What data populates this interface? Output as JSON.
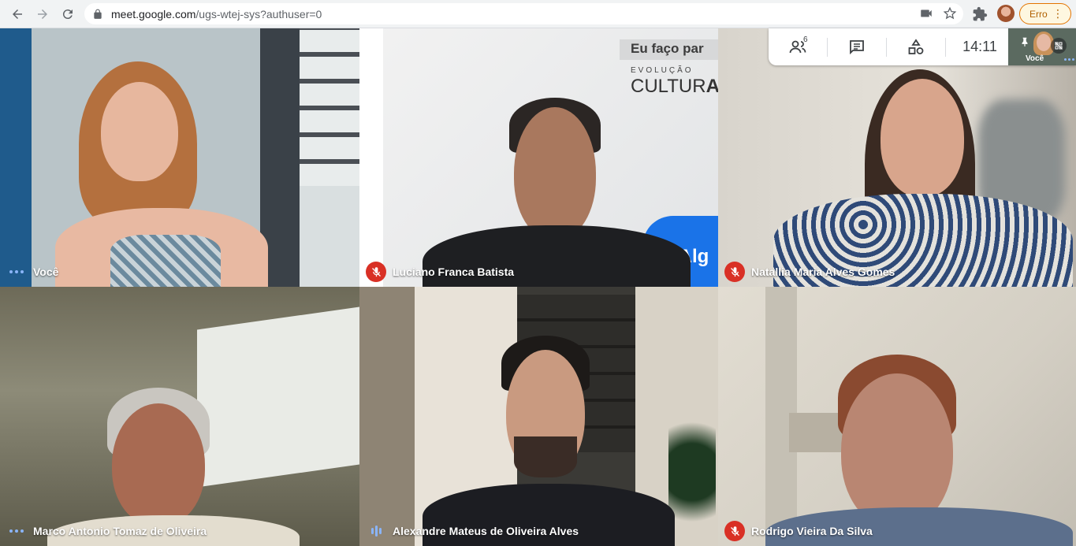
{
  "browser": {
    "url_host": "meet.google.com",
    "url_path": "/ugs-wtej-sys?authuser=0",
    "profile_button_label": "Erro"
  },
  "meeting_bar": {
    "participant_count": "6",
    "clock": "14:11",
    "self_view_label": "Você"
  },
  "participants": [
    {
      "name": "Você",
      "status": "speaking-dots"
    },
    {
      "name": "Luciano Franca Batista",
      "status": "muted"
    },
    {
      "name": "Natallia Maria Alves Gomes",
      "status": "muted"
    },
    {
      "name": "Marco Antonio Tomaz de Oliveira",
      "status": "speaking-dots"
    },
    {
      "name": "Alexandre Mateus de Oliveira Alves",
      "status": "speaking-bars"
    },
    {
      "name": "Rodrigo Vieira Da Silva",
      "status": "muted"
    }
  ],
  "backdrop": {
    "banner_text": "Eu faço par",
    "sub_text": "EVOLUÇÃO",
    "brand_text_a": "CULTUR",
    "brand_text_b": "AL",
    "logo_fragment": "iAlg"
  },
  "colors": {
    "muted_red": "#d93025",
    "speaking_blue": "#8ab4f8",
    "error_orange": "#e37400"
  }
}
